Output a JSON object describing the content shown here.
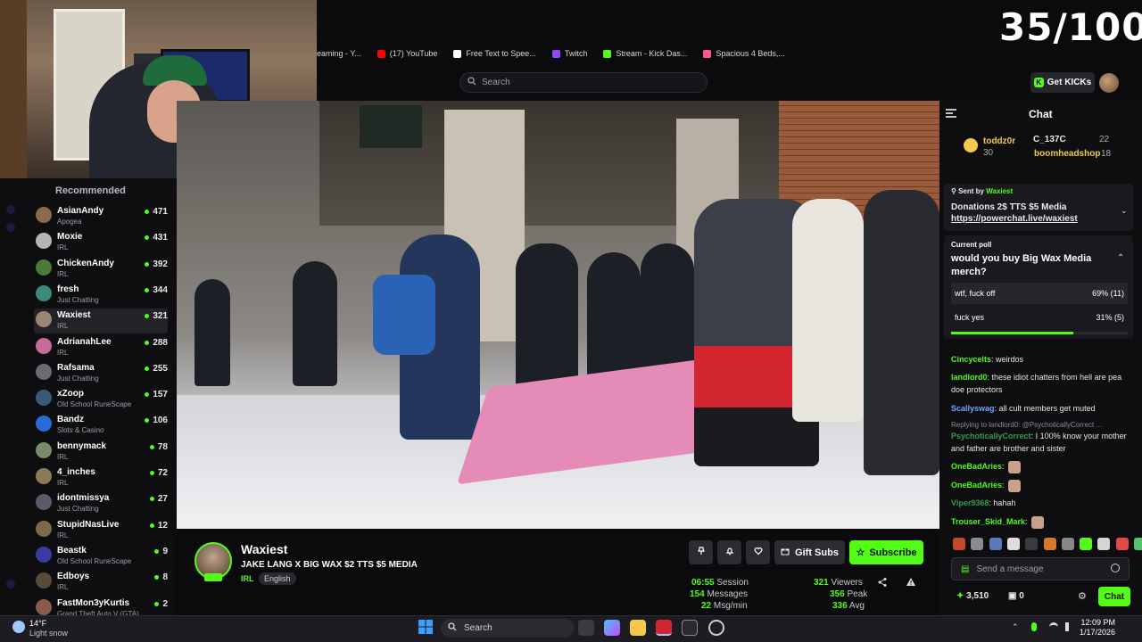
{
  "counter": "35/100",
  "bookmarks": [
    {
      "label": "eaming - Y...",
      "color": "#ff3b3b"
    },
    {
      "label": "(17) YouTube",
      "color": "#ff0000"
    },
    {
      "label": "Free Text to Spee...",
      "color": "#ffffff"
    },
    {
      "label": "Twitch",
      "color": "#9146ff"
    },
    {
      "label": "Stream - Kick Das...",
      "color": "#53fc18"
    },
    {
      "label": "Spacious 4 Beds,...",
      "color": "#ff5a8c"
    }
  ],
  "search": {
    "placeholder": "Search"
  },
  "header": {
    "get_kicks": "Get KICKs"
  },
  "sidebar": {
    "title": "Recommended",
    "channels": [
      {
        "name": "AsianAndy",
        "category": "Apogea",
        "viewers": "471",
        "color": "#8a6a4a"
      },
      {
        "name": "Moxie",
        "category": "IRL",
        "viewers": "431",
        "color": "#b5b5b5"
      },
      {
        "name": "ChickenAndy",
        "category": "IRL",
        "viewers": "392",
        "color": "#4a7a3a"
      },
      {
        "name": "fresh",
        "category": "Just Chatting",
        "viewers": "344",
        "color": "#3a8a7a"
      },
      {
        "name": "Waxiest",
        "category": "IRL",
        "viewers": "321",
        "color": "#9a8670"
      },
      {
        "name": "AdrianahLee",
        "category": "IRL",
        "viewers": "288",
        "color": "#c56a9a"
      },
      {
        "name": "Rafsama",
        "category": "Just Chatting",
        "viewers": "255",
        "color": "#6a6a70"
      },
      {
        "name": "xZoop",
        "category": "Old School RuneScape",
        "viewers": "157",
        "color": "#3a5a7a"
      },
      {
        "name": "Bandz",
        "category": "Slots & Casino",
        "viewers": "106",
        "color": "#2a6ad6"
      },
      {
        "name": "bennymack",
        "category": "IRL",
        "viewers": "78",
        "color": "#7a8a6a"
      },
      {
        "name": "4_inches",
        "category": "IRL",
        "viewers": "72",
        "color": "#8a7a5a"
      },
      {
        "name": "idontmissya",
        "category": "Just Chatting",
        "viewers": "27",
        "color": "#5a5a6a"
      },
      {
        "name": "StupidNasLive",
        "category": "IRL",
        "viewers": "12",
        "color": "#7a6a4a"
      },
      {
        "name": "Beastk",
        "category": "Old School RuneScape",
        "viewers": "9",
        "color": "#3a3aa0"
      },
      {
        "name": "Edboys",
        "category": "IRL",
        "viewers": "8",
        "color": "#5a4a3a"
      },
      {
        "name": "FastMon3yKurtis",
        "category": "Grand Theft Auto V (GTA)",
        "viewers": "2",
        "color": "#8a5a4a"
      }
    ]
  },
  "stream": {
    "name": "Waxiest",
    "title": "JAKE LANG X BIG WAX $2 TTS $5 MEDIA",
    "category": "IRL",
    "language": "English",
    "gift_label": "Gift Subs",
    "subscribe_label": "Subscribe",
    "stats": {
      "session": "06:55",
      "session_label": "Session",
      "messages": "154",
      "messages_label": "Messages",
      "rate": "22",
      "rate_label": "Msg/min",
      "viewers": "321",
      "viewers_label": "Viewers",
      "peak": "356",
      "peak_label": "Peak",
      "avg": "336",
      "avg_label": "Avg"
    }
  },
  "chat": {
    "title": "Chat",
    "leaderboard": [
      {
        "name": "toddz0r",
        "points": "30",
        "color": "#f2c94c"
      },
      {
        "name": "C_137C",
        "points": "22",
        "color": "#e8e8ec"
      },
      {
        "name": "boomheadshop",
        "points": "18",
        "color": "#f2c94c"
      }
    ],
    "pinned": {
      "sent_by_label": "Sent by",
      "sender": "Waxiest",
      "text": "Donations 2$ TTS $5 Media",
      "link": "https://powerchat.live/waxiest"
    },
    "poll": {
      "label": "Current poll",
      "question": "would you buy Big Wax Media merch?",
      "options": [
        {
          "text": "wtf, fuck off",
          "result": "69% (11)",
          "fraction": 0.69
        },
        {
          "text": "fuck yes",
          "result": "31% (5)",
          "fraction": 0.31
        }
      ]
    },
    "messages": [
      {
        "user": "Cincycelts",
        "text": " weirdos",
        "color": "#53fc18"
      },
      {
        "user": "landlord0",
        "text": " these idiot chatters from hell are pea doe protectors",
        "color": "#53fc18"
      },
      {
        "user": "Scallyswag",
        "text": " all cult members get muted",
        "color": "#6ea8ff"
      },
      {
        "user": "PsychoticallyCorrect",
        "text": " I 100% know your mother and father are brother and sister",
        "color": "#2f9e4a",
        "reply": "Replying to landlord0: @PsychoticallyCorrect ..."
      },
      {
        "user": "OneBadAries",
        "text": "",
        "color": "#53fc18"
      },
      {
        "user": "OneBadAries",
        "text": "",
        "color": "#53fc18"
      },
      {
        "user": "Viper9368",
        "text": " hahah",
        "color": "#2f9e4a"
      },
      {
        "user": "Trouser_Skid_Mark",
        "text": "",
        "color": "#53fc18"
      }
    ],
    "input_placeholder": "Send a message",
    "kicks": "3,510",
    "count": "0",
    "send_label": "Chat"
  },
  "taskbar": {
    "temp": "14°F",
    "weather": "Light snow",
    "search": "Search",
    "time": "12:09 PM",
    "date": "1/17/2026"
  }
}
